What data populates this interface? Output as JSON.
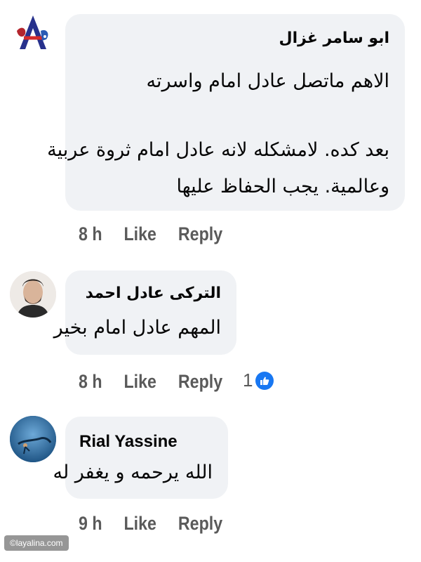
{
  "comments": [
    {
      "author": "ابو سامر غزال",
      "text_lines": [
        "الاهم ماتصل عادل امام واسرته",
        "بعد كده. لامشكله لانه عادل امام ثروة عربية",
        "وعالمية. يجب الحفاظ عليها"
      ],
      "time": "8 h",
      "like_label": "Like",
      "reply_label": "Reply"
    },
    {
      "author": "التركى عادل احمد",
      "text_lines": [
        "المهم عادل امام بخير"
      ],
      "time": "8 h",
      "like_label": "Like",
      "reply_label": "Reply",
      "reaction_count": "1",
      "reaction_icon": "like-icon"
    },
    {
      "author": "Rial Yassine",
      "text_lines": [
        "الله يرحمه و يغفر له"
      ],
      "time": "9 h",
      "like_label": "Like",
      "reply_label": "Reply"
    }
  ],
  "watermark": "©layalina.com",
  "colors": {
    "bubble": "#f0f2f5",
    "like_blue": "#1877f2",
    "meta_text": "#5a5a5a"
  }
}
